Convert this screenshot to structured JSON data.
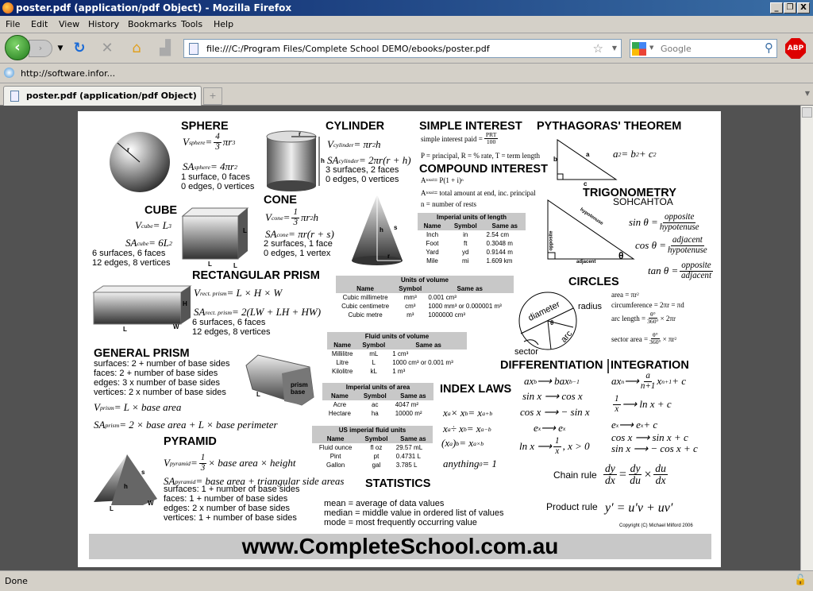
{
  "window": {
    "title": "poster.pdf (application/pdf Object) - Mozilla Firefox",
    "minimize": "_",
    "restore": "❐",
    "close": "X"
  },
  "menu": [
    "File",
    "Edit",
    "View",
    "History",
    "Bookmarks",
    "Tools",
    "Help"
  ],
  "nav": {
    "url": "file:///C:/Program Files/Complete School DEMO/ebooks/poster.pdf",
    "search_placeholder": "Google",
    "bookmark": "http://software.infor...",
    "abp": "ABP"
  },
  "tabs": [
    {
      "label": "poster.pdf (application/pdf Object)",
      "active": true
    }
  ],
  "status": "Done",
  "poster": {
    "headings": {
      "sphere": "SPHERE",
      "cylinder": "CYLINDER",
      "simple_interest": "SIMPLE INTEREST",
      "pythagoras": "PYTHAGORAS' THEOREM",
      "compound_interest": "COMPOUND INTEREST",
      "cube": "CUBE",
      "cone": "CONE",
      "trigonometry": "TRIGONOMETRY",
      "rect_prism": "RECTANGULAR PRISM",
      "circles": "CIRCLES",
      "general_prism": "GENERAL PRISM",
      "diff": "DIFFERENTIATION",
      "integ": "INTEGRATION",
      "index_laws": "INDEX LAWS",
      "pyramid": "PYRAMID",
      "statistics": "STATISTICS"
    },
    "texts": {
      "sphere_props": [
        "1 surface, 0 faces",
        "0 edges, 0 vertices"
      ],
      "cylinder_props": [
        "3 surfaces, 2 faces",
        "0 edges, 0 vertices"
      ],
      "cube_props": [
        "6 surfaces, 6 faces",
        "12 edges, 8 vertices"
      ],
      "cone_props": [
        "2 surfaces, 1 face",
        "0 edges, 1 vertex"
      ],
      "rect_props": [
        "6 surfaces, 6 faces",
        "12 edges, 8 vertices"
      ],
      "gprism_props": [
        "surfaces: 2 + number of base sides",
        "faces: 2 + number of base sides",
        "edges: 3 x number of base sides",
        "vertices: 2 x number of base sides"
      ],
      "pyramid_props": [
        "surfaces: 1 + number of base sides",
        "faces: 1 + number of base sides",
        "edges: 2 x number of base sides",
        "vertices: 1 + number of base sides"
      ],
      "stats": [
        "mean = average of data values",
        "median = middle value in ordered list of values",
        "mode = most frequently occurring value"
      ],
      "sohcahtoa": [
        "SOHCAHTOA"
      ],
      "chain_label": [
        "Chain rule"
      ],
      "product_label": [
        "Product rule"
      ],
      "copyright": [
        "Copyright (C) Michael Milford 2006"
      ]
    },
    "formulas": {
      "v_sphere": [
        "V",
        {
          "sub": "sphere"
        },
        " = ",
        {
          "frac": [
            "4",
            "3"
          ]
        },
        "πr",
        {
          "sup": "3"
        }
      ],
      "sa_sphere": [
        "SA",
        {
          "sub": "sphere"
        },
        " = 4πr",
        {
          "sup": "2"
        }
      ],
      "v_cyl": [
        "V",
        {
          "sub": "cylinder"
        },
        " = πr",
        {
          "sup": "2"
        },
        "h"
      ],
      "sa_cyl": [
        "SA",
        {
          "sub": "cylinder"
        },
        " = 2πr(r + h)"
      ],
      "v_cube": [
        "V",
        {
          "sub": "cube"
        },
        " = L",
        {
          "sup": "3"
        }
      ],
      "sa_cube": [
        "SA",
        {
          "sub": "cube"
        },
        " = 6L",
        {
          "sup": "2"
        }
      ],
      "v_cone": [
        "V",
        {
          "sub": "cone"
        },
        " = ",
        {
          "frac": [
            "1",
            "3"
          ]
        },
        "πr",
        {
          "sup": "2"
        },
        "h"
      ],
      "sa_cone": [
        "SA",
        {
          "sub": "cone"
        },
        " = πr(r + s)"
      ],
      "v_rect": [
        "V",
        {
          "sub": "rect. prism"
        },
        " = L × H × W"
      ],
      "sa_rect": [
        "SA",
        {
          "sub": "rect. prism"
        },
        " = 2(LW + LH + HW)"
      ],
      "v_prism": [
        "V",
        {
          "sub": "prism"
        },
        " = L × base area"
      ],
      "sa_prism": [
        "SA",
        {
          "sub": "prism"
        },
        " = 2 × base area + L × base perimeter"
      ],
      "v_pyr": [
        "V",
        {
          "sub": "pyramid"
        },
        " = ",
        {
          "frac": [
            "1",
            "3"
          ]
        },
        "× base area × height"
      ],
      "sa_pyr": [
        "SA",
        {
          "sub": "pyramid"
        },
        " = base area + triangular side areas"
      ],
      "si": [
        "simple interest paid = ",
        {
          "frac": [
            "PRT",
            "100"
          ]
        }
      ],
      "si2": [
        "P = principal, R = % rate, T = term length"
      ],
      "ci": [
        "A",
        {
          "sub": "total"
        },
        " = P(1 + i)",
        {
          "sup": "n"
        }
      ],
      "ci2": [
        "A",
        {
          "sub": "total"
        },
        " = total amount at end, inc. principal"
      ],
      "ci3": [
        "n = number of rests"
      ],
      "pyth": [
        "a",
        {
          "sup": "2"
        },
        " = b",
        {
          "sup": "2"
        },
        " + c",
        {
          "sup": "2"
        }
      ],
      "sin": [
        "sin θ = ",
        {
          "frac": [
            "opposite",
            "hypotenuse"
          ]
        }
      ],
      "cos": [
        "cos θ = ",
        {
          "frac": [
            "adjacent",
            "hypotenuse"
          ]
        }
      ],
      "tan": [
        "tan θ = ",
        {
          "frac": [
            "opposite",
            "adjacent"
          ]
        }
      ],
      "c_area": [
        "area = πr",
        {
          "sup": "2"
        }
      ],
      "c_circ": [
        "circumference = 2πr = πd"
      ],
      "c_arc": [
        "arc length = ",
        {
          "frac": [
            "θ°",
            "360°"
          ]
        },
        "× 2πr"
      ],
      "c_sector": [
        "sector area = ",
        {
          "frac": [
            "θ°",
            "360°"
          ]
        },
        "× πr",
        {
          "sup": "2"
        }
      ],
      "d1": [
        "ax",
        {
          "sup": "b"
        },
        " ⟶ bax",
        {
          "sup": "b−1"
        }
      ],
      "d2": [
        "sin x ⟶ cos x"
      ],
      "d3": [
        "cos x ⟶ − sin x"
      ],
      "d4": [
        "e",
        {
          "sup": "x"
        },
        " ⟶ e",
        {
          "sup": "x"
        }
      ],
      "d5": [
        "ln x ⟶ ",
        {
          "frac": [
            "1",
            "x"
          ]
        },
        ", x > 0"
      ],
      "i1": [
        "ax",
        {
          "sup": "n"
        },
        " ⟶ ",
        {
          "frac": [
            "a",
            "n+1"
          ]
        },
        "x",
        {
          "sup": "n+1"
        },
        " + c"
      ],
      "i2": [
        {
          "frac": [
            "1",
            "x"
          ]
        },
        " ⟶ ln x + c"
      ],
      "i3": [
        "e",
        {
          "sup": "x"
        },
        " ⟶ e",
        {
          "sup": "x"
        },
        " + c"
      ],
      "i4": [
        "cos x ⟶ sin x + c"
      ],
      "i5": [
        "sin x ⟶ − cos x + c"
      ],
      "x1": [
        "x",
        {
          "sup": "a"
        },
        " × x",
        {
          "sup": "b"
        },
        " = x",
        {
          "sup": "a+b"
        }
      ],
      "x2": [
        "x",
        {
          "sup": "a"
        },
        " ÷ x",
        {
          "sup": "b"
        },
        " = x",
        {
          "sup": "a−b"
        }
      ],
      "x3": [
        "(x",
        {
          "sup": "a"
        },
        ")",
        {
          "sup": "b"
        },
        " = x",
        {
          "sup": "a×b"
        }
      ],
      "x4": [
        "anything",
        {
          "sup": "0"
        },
        " = 1"
      ],
      "chain": [
        {
          "frac": [
            "dy",
            "dx"
          ]
        },
        "=",
        {
          "frac": [
            "dy",
            "du"
          ]
        },
        "×",
        {
          "frac": [
            "du",
            "dx"
          ]
        }
      ],
      "product": [
        "y′ = u′v + uv′"
      ]
    },
    "labels": {
      "sphere_r": "r",
      "cyl_r": "r",
      "cyl_h": "h",
      "cube_l1": "L",
      "cube_l2": "L",
      "cube_l3": "L",
      "cone_h": "h",
      "cone_s": "s",
      "cone_r": "r",
      "rect_h": "H",
      "rect_l": "L",
      "rect_w": "W",
      "prism_base": "prism base",
      "prism_l": "L",
      "pyr_h": "h",
      "pyr_s": "s",
      "pyr_l": "L",
      "pyr_w": "W",
      "pyth_a": "a",
      "pyth_b": "b",
      "pyth_c": "c",
      "trig_opp": "opposite",
      "trig_hyp": "hypotenuse",
      "trig_adj": "adjacent",
      "trig_theta": "θ",
      "c_radius": "radius",
      "c_diameter": "diameter",
      "c_arc": "arc",
      "c_sector": "sector",
      "c_theta": "θ"
    },
    "tables": [
      {
        "key": "length",
        "title": "Imperial units of length",
        "columns": [
          "Name",
          "Symbol",
          "Same as"
        ],
        "rows": [
          [
            "Inch",
            "in",
            "2.54 cm"
          ],
          [
            "Foot",
            "ft",
            "0.3048 m"
          ],
          [
            "Yard",
            "yd",
            "0.9144 m"
          ],
          [
            "Mile",
            "mi",
            "1.609 km"
          ]
        ]
      },
      {
        "key": "volume",
        "title": "Units of volume",
        "columns": [
          "Name",
          "Symbol",
          "Same as"
        ],
        "rows": [
          [
            "Cubic millimetre",
            "mm³",
            "0.001 cm³"
          ],
          [
            "Cubic centimetre",
            "cm³",
            "1000 mm³ or 0.000001 m³"
          ],
          [
            "Cubic metre",
            "m³",
            "1000000 cm³"
          ]
        ]
      },
      {
        "key": "fluid",
        "title": "Fluid units of volume",
        "columns": [
          "Name",
          "Symbol",
          "Same as"
        ],
        "rows": [
          [
            "Millilitre",
            "mL",
            "1 cm³"
          ],
          [
            "Litre",
            "L",
            "1000 cm³ or 0.001 m³"
          ],
          [
            "Kilolitre",
            "kL",
            "1 m³"
          ]
        ]
      },
      {
        "key": "area",
        "title": "Imperial units of area",
        "columns": [
          "Name",
          "Symbol",
          "Same as"
        ],
        "rows": [
          [
            "Acre",
            "ac",
            "4047 m²"
          ],
          [
            "Hectare",
            "ha",
            "10000 m²"
          ]
        ]
      },
      {
        "key": "usfluid",
        "title": "US imperial fluid units",
        "columns": [
          "Name",
          "Symbol",
          "Same as"
        ],
        "rows": [
          [
            "Fluid ounce",
            "fl oz",
            "29.57 mL"
          ],
          [
            "Pint",
            "pt",
            "0.4731 L"
          ],
          [
            "Gallon",
            "gal",
            "3.785 L"
          ]
        ]
      }
    ],
    "banner": "www.CompleteSchool.com.au"
  }
}
